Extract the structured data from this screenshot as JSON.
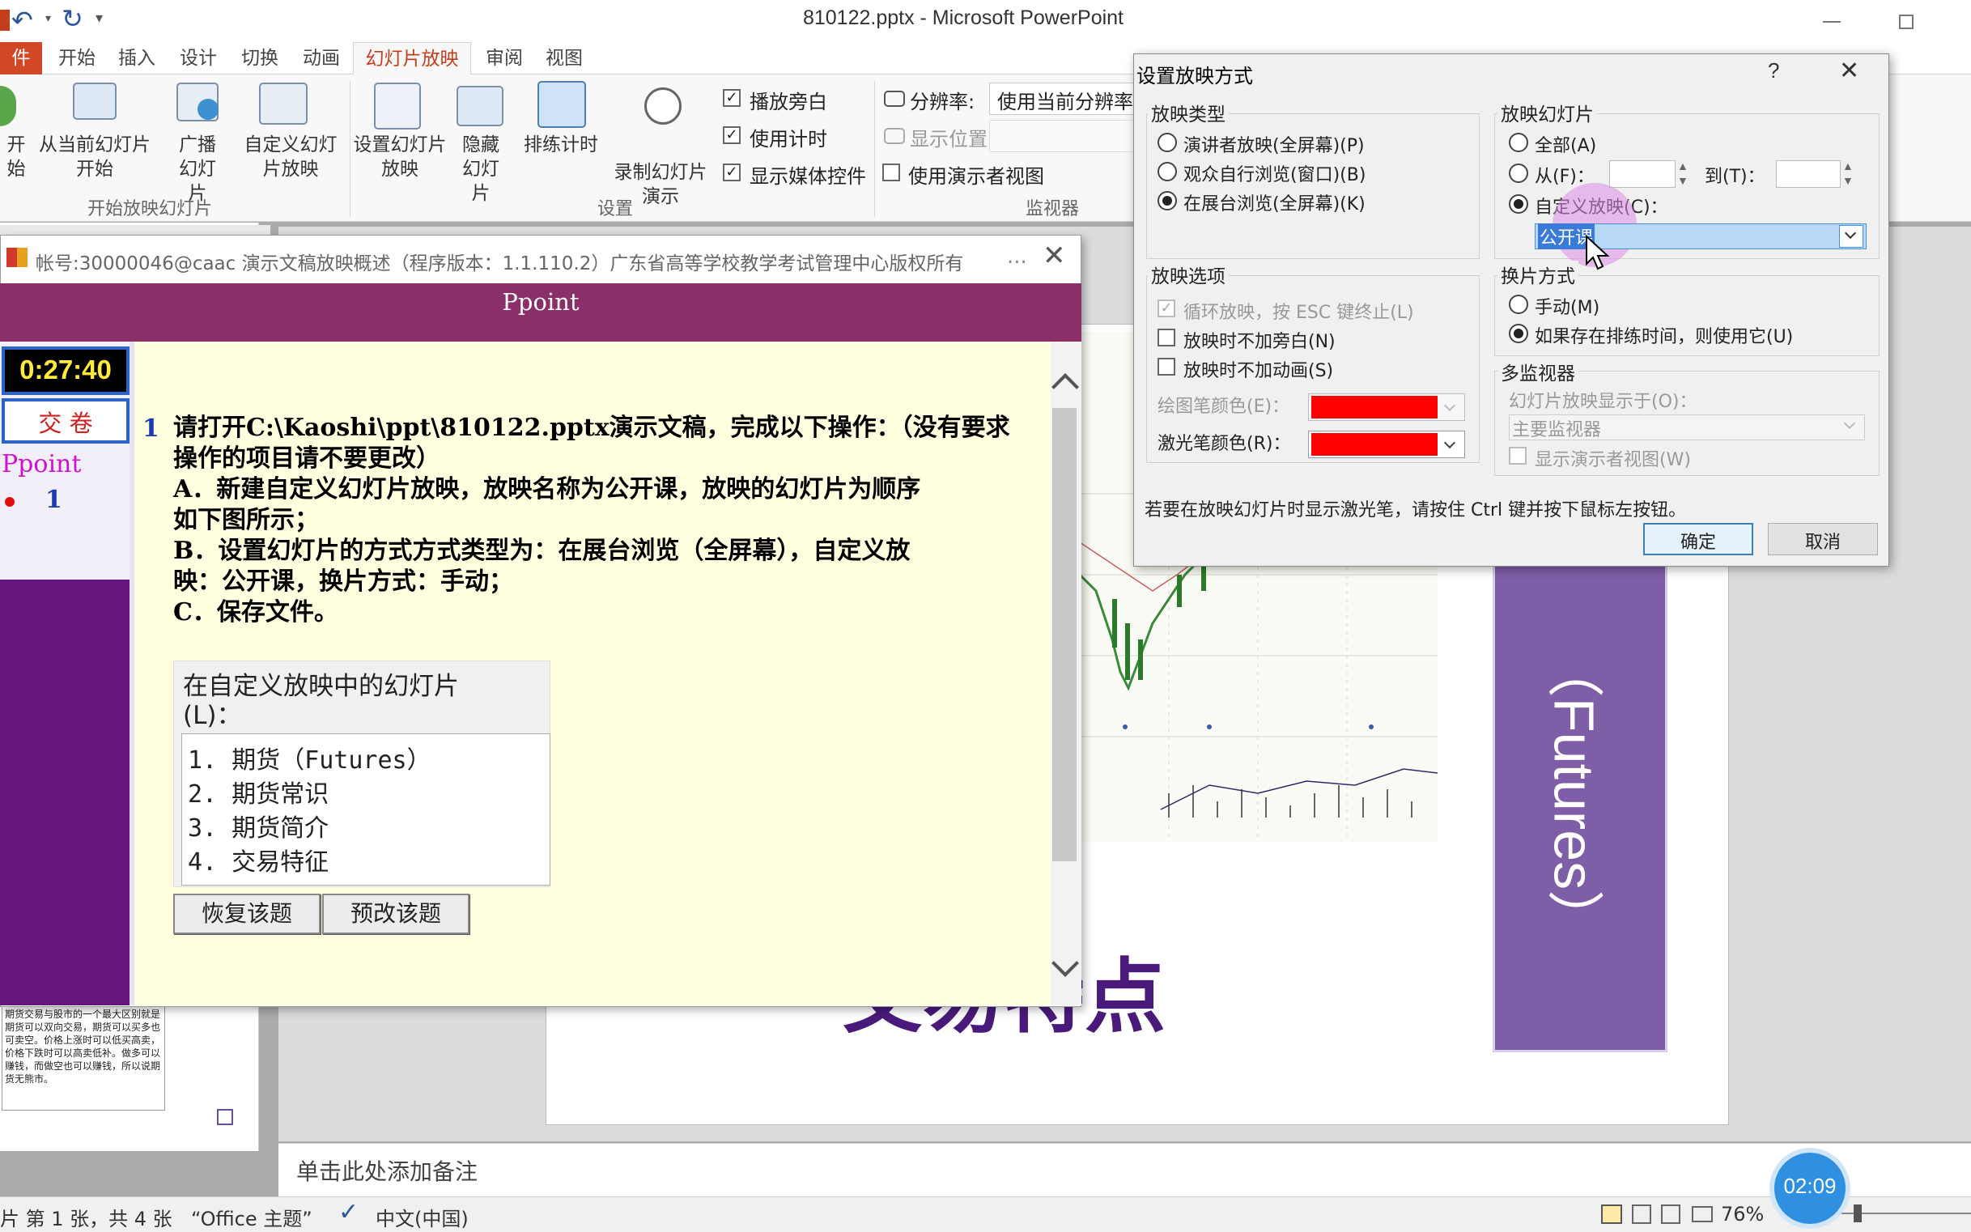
{
  "app": {
    "quick_access": [
      "undo",
      "redo"
    ],
    "window_title": "810122.pptx - Microsoft PowerPoint",
    "tabs": [
      "件",
      "开始",
      "插入",
      "设计",
      "切换",
      "动画",
      "幻灯片放映",
      "审阅",
      "视图"
    ],
    "ribbon": {
      "groups": [
        "开始放映幻灯片",
        "设置",
        "监视器"
      ],
      "btn_from_start": "开始",
      "btn_from_current": "从当前幻灯片开始",
      "btn_broadcast": "广播幻灯片",
      "btn_custom": "自定义幻灯片放映",
      "btn_setup": "设置幻灯片放映",
      "btn_hide": "隐藏幻灯片",
      "btn_rehearse": "排练计时",
      "btn_record": "录制幻灯片演示",
      "chk_narration": "播放旁白",
      "chk_timings": "使用计时",
      "chk_media": "显示媒体控件",
      "resolution_label": "分辨率:",
      "resolution_value": "使用当前分辨率",
      "show_on_label": "显示位置:",
      "presenter_view_label": "使用演示者视图"
    },
    "thumb_text": "期货交易与股市的一个最大区别就是期货可以双向交易，期货可以买多也可卖空。价格上涨时可以低买高卖，价格下跌时可以高卖低补。做多可以赚钱，而做空也可以赚钱，所以说期货无熊市。",
    "notes_placeholder": "单击此处添加备注",
    "status": {
      "slide": "片 第 1 张，共 4 张",
      "theme": "“Office 主题”",
      "language": "中文(中国)",
      "zoom": "76%"
    },
    "slide": {
      "vertical_text": "（Futures）",
      "title_fragment": "交易特点"
    }
  },
  "exam": {
    "window_title": "帐号:30000046@caac  演示文稿放映概述（程序版本：1.1.110.2）广东省高等学校教学考试管理中心版权所有",
    "more": "...",
    "header": "Ppoint",
    "timer": "0:27:40",
    "submit": "交 卷",
    "category": "Ppoint",
    "question_index": "1",
    "question_number": "1",
    "question_text": [
      "请打开C:\\Kaoshi\\ppt\\810122.pptx演示文稿，完成以下操作：（没有要求",
      "操作的项目请不要更改）",
      "A．新建自定义幻灯片放映，放映名称为公开课，放映的幻灯片为顺序",
      "如下图所示；",
      "B．设置幻灯片的方式方式类型为：在展台浏览（全屏幕），自定义放",
      "映：公开课，换片方式：手动；",
      "C．保存文件。"
    ],
    "figure_title": "在自定义放映中的幻灯片",
    "figure_title2": "(L)：",
    "figure_items": [
      "1.  期货（Futures）",
      "2.  期货常识",
      "3.  期货简介",
      "4.  交易特征"
    ],
    "btn_restore": "恢复该题",
    "btn_preedit": "预改该题"
  },
  "dialog": {
    "title": "设置放映方式",
    "help": "?",
    "show_type": {
      "legend": "放映类型",
      "options": [
        "演讲者放映(全屏幕)(P)",
        "观众自行浏览(窗口)(B)",
        "在展台浏览(全屏幕)(K)"
      ],
      "selected": 2
    },
    "show_options": {
      "legend": "放映选项",
      "loop": "循环放映，按 ESC 键终止(L)",
      "no_narration": "放映时不加旁白(N)",
      "no_animation": "放映时不加动画(S)",
      "pen_color": "绘图笔颜色(E)：",
      "laser_color": "激光笔颜色(R)：",
      "color_value": "#ff0000"
    },
    "show_slides": {
      "legend": "放映幻灯片",
      "all": "全部(A)",
      "from": "从(F)：",
      "to": "到(T)：",
      "custom": "自定义放映(C)：",
      "custom_value": "公开课",
      "selected": "custom"
    },
    "advance": {
      "legend": "换片方式",
      "manual": "手动(M)",
      "timings": "如果存在排练时间，则使用它(U)",
      "selected": "timings"
    },
    "monitors": {
      "legend": "多监视器",
      "show_on": "幻灯片放映显示于(O)：",
      "monitor_value": "主要监视器",
      "presenter_view": "显示演示者视图(W)"
    },
    "hint": "若要在放映幻灯片时显示激光笔，请按住 Ctrl 键并按下鼠标左按钮。",
    "ok": "确定",
    "cancel": "取消"
  },
  "recording_timer": "02:09"
}
